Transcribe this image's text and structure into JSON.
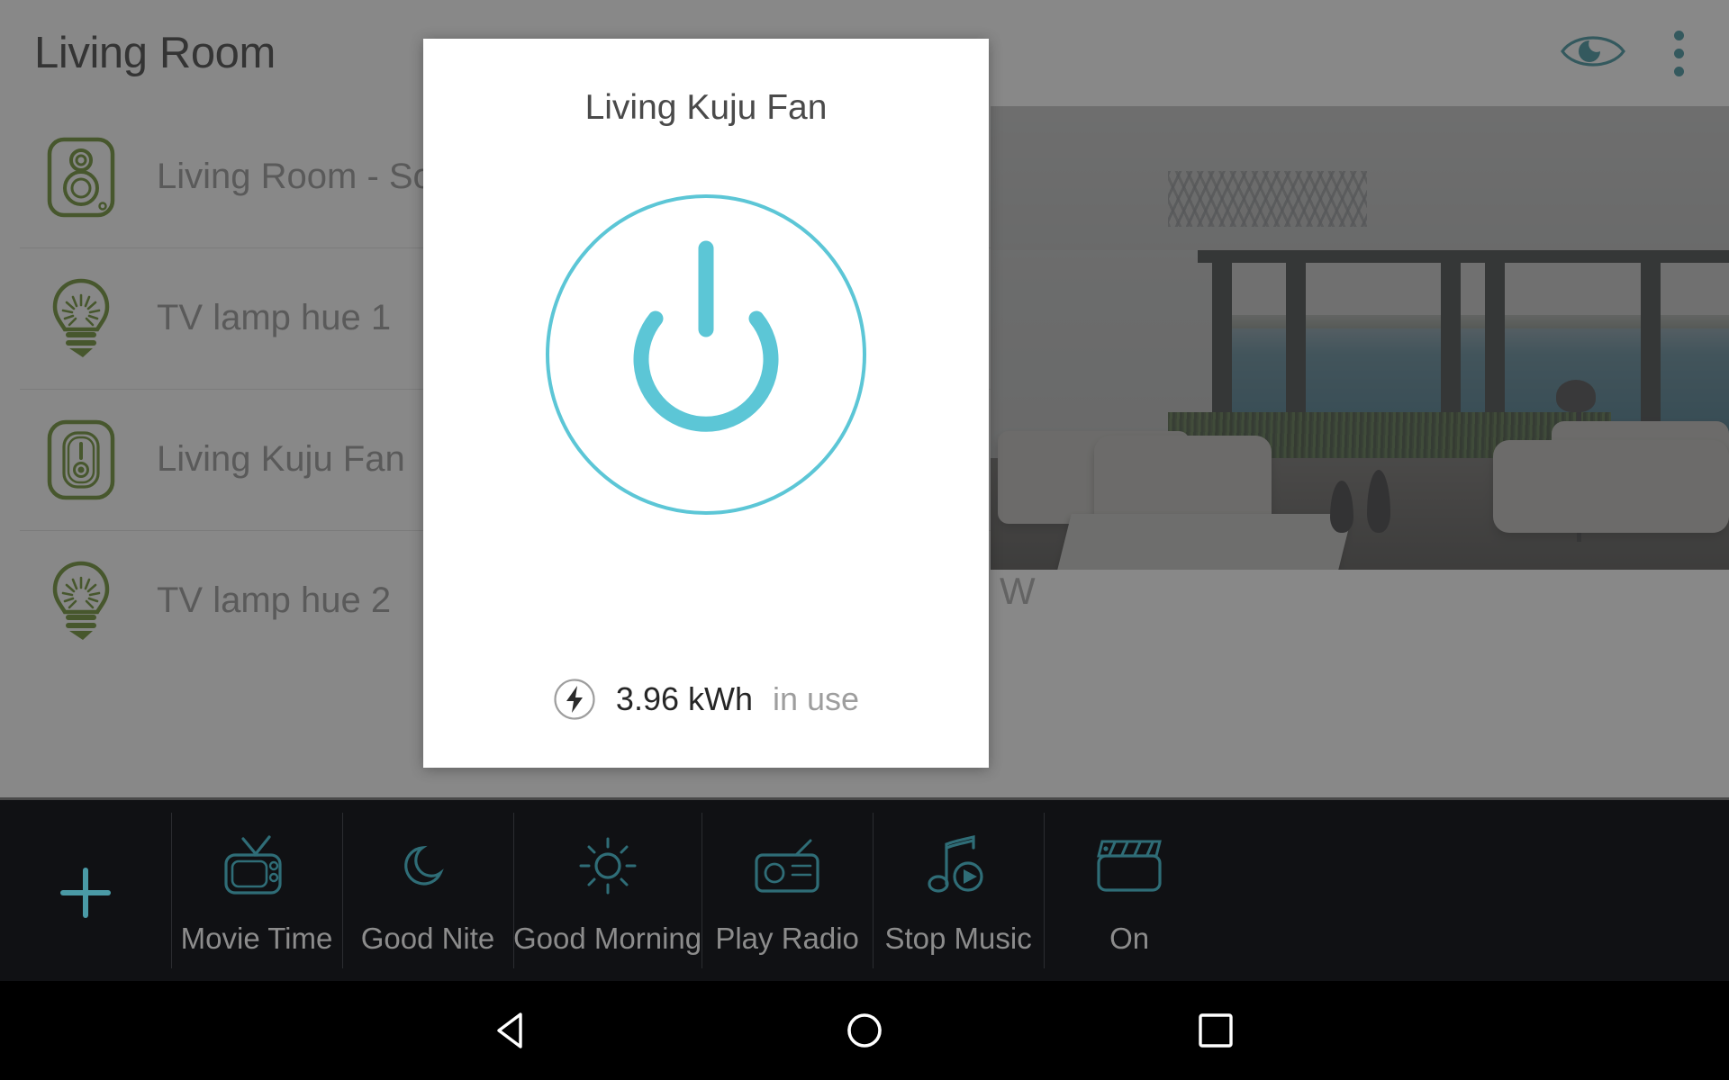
{
  "header": {
    "title": "Living Room",
    "actions": [
      {
        "name": "eye-icon",
        "label": "Visibility"
      },
      {
        "name": "overflow-menu-icon",
        "label": "More options"
      }
    ]
  },
  "device_list": [
    {
      "label": "Living Room - Sonos",
      "icon": "speaker-icon"
    },
    {
      "label": "TV lamp hue 1",
      "icon": "light-bulb-icon"
    },
    {
      "label": "Living Kuju Fan",
      "icon": "smart-plug-icon"
    },
    {
      "label": "TV lamp hue 2",
      "icon": "light-bulb-icon"
    }
  ],
  "photo_caption": "W",
  "dialog": {
    "title": "Living Kuju Fan",
    "power_icon": "power-icon",
    "power_state_color": "#5cc6d6",
    "energy": {
      "icon": "lightning-bolt-icon",
      "value": "3.96 kWh",
      "state": "in use"
    }
  },
  "scene_bar": {
    "add_label": "+",
    "scenes": [
      {
        "label": "Movie Time",
        "icon": "tv-icon"
      },
      {
        "label": "Good Nite",
        "icon": "moon-icon"
      },
      {
        "label": "Good Morning",
        "icon": "sun-icon"
      },
      {
        "label": "Play Radio",
        "icon": "radio-icon"
      },
      {
        "label": "Stop Music",
        "icon": "music-note-play-icon"
      },
      {
        "label": "On",
        "icon": "clapperboard-icon"
      }
    ]
  },
  "navbar": {
    "buttons": [
      {
        "name": "back-button",
        "label": "Back"
      },
      {
        "name": "home-button",
        "label": "Home"
      },
      {
        "name": "recents-button",
        "label": "Recents"
      }
    ]
  },
  "colors": {
    "accent_teal": "#1d7f8c",
    "device_icon_green": "#4f7a0b",
    "dialog_accent": "#5cc6d6",
    "scene_icon": "#2f6d77"
  }
}
